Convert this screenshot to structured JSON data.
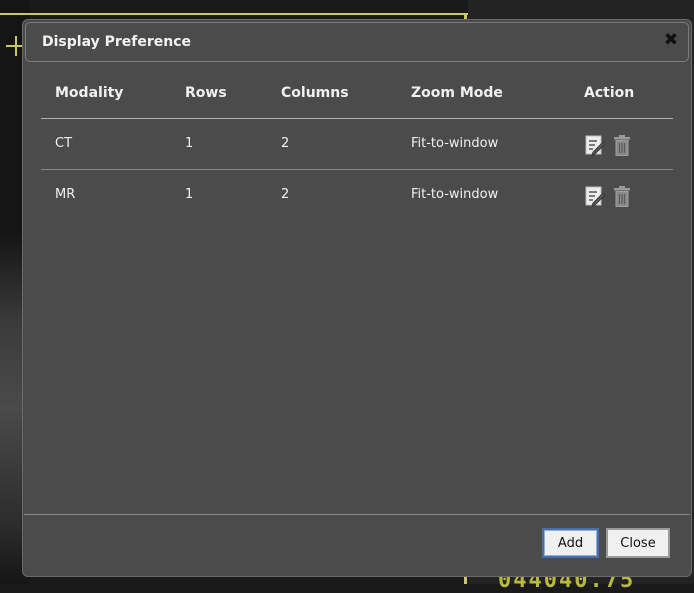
{
  "background": {
    "overlay_text": "044040.75"
  },
  "dialog": {
    "title": "Display Preference",
    "close_icon": "close-icon",
    "columns": [
      "Modality",
      "Rows",
      "Columns",
      "Zoom Mode",
      "Action"
    ],
    "rows": [
      {
        "modality": "CT",
        "rows": "1",
        "columns": "2",
        "zoom_mode": "Fit-to-window"
      },
      {
        "modality": "MR",
        "rows": "1",
        "columns": "2",
        "zoom_mode": "Fit-to-window"
      }
    ],
    "action_icons": [
      "edit-icon",
      "delete-icon"
    ],
    "buttons": {
      "add": "Add",
      "close": "Close"
    }
  },
  "colors": {
    "dialog_bg": "#4b4b4b",
    "accent_yellow": "#c8c86a",
    "button_focus": "#4a6ea8"
  }
}
